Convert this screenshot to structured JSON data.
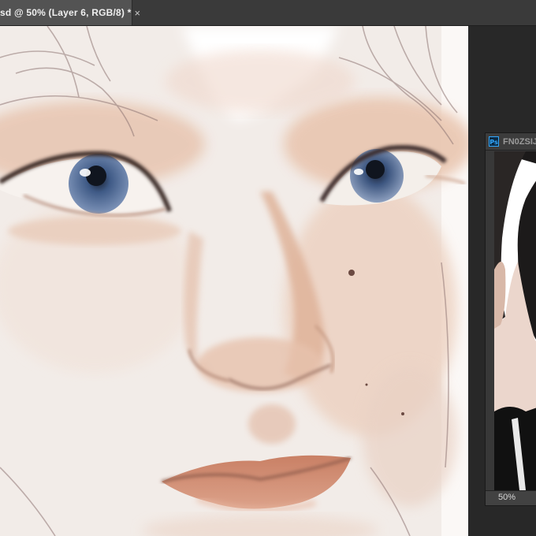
{
  "document": {
    "tab_title": "sd @ 50% (Layer 6, RGB/8) *",
    "close_glyph": "×",
    "canvas_content": "digital painting portrait of a face (eyes, nose, lips)",
    "colors": {
      "skin_light": "#f3eeea",
      "skin_warm": "#e9c3aa",
      "iris": "#5b78a3",
      "lips": "#cf8f72"
    }
  },
  "reference_window": {
    "icon": "Ps",
    "title": "FN0ZSIJ",
    "zoom": "50%",
    "content": "reference photo of a person with dark hair"
  }
}
